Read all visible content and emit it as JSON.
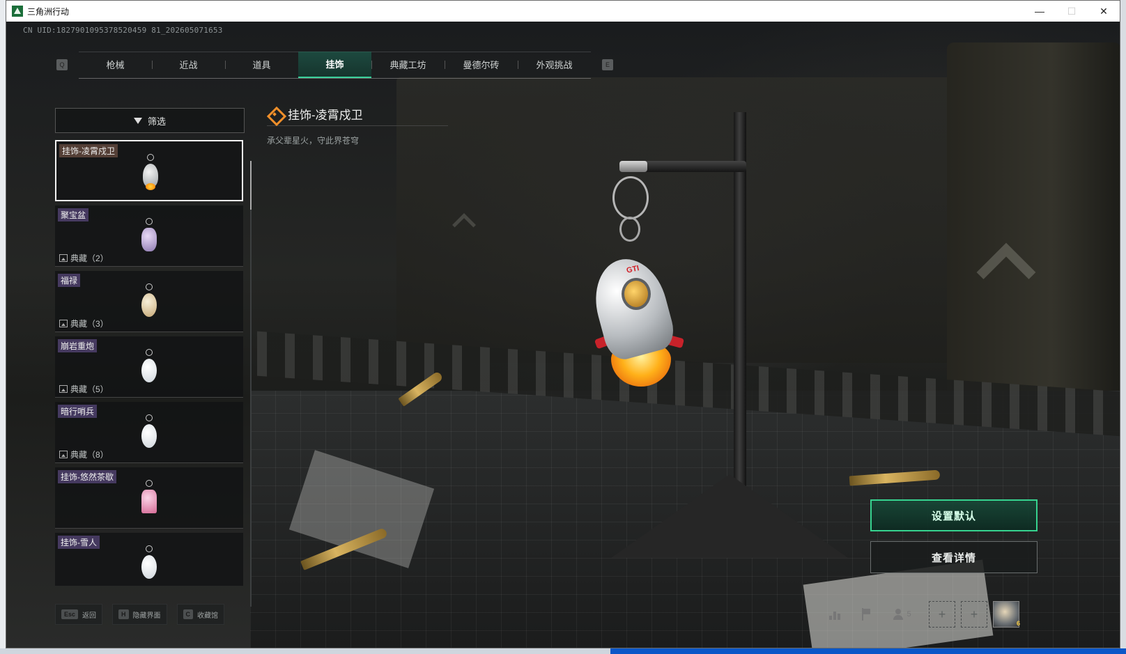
{
  "window": {
    "title": "三角洲行动",
    "controls": [
      "—",
      "☐",
      "✕"
    ]
  },
  "uid": "CN UID:1827901095378520459 81_202605071653",
  "tabs": {
    "left_key": "Q",
    "right_key": "E",
    "items": [
      {
        "label": "枪械"
      },
      {
        "label": "近战"
      },
      {
        "label": "道具"
      },
      {
        "label": "挂饰",
        "active": true
      },
      {
        "label": "典藏工坊"
      },
      {
        "label": "曼德尔砖"
      },
      {
        "label": "外观挑战"
      }
    ]
  },
  "sidebar": {
    "filter_label": "筛选",
    "items": [
      {
        "name": "挂饰-凌霄戍卫",
        "collect": "",
        "style": "rocket",
        "selected": true
      },
      {
        "name": "聚宝盆",
        "collect": "典藏（2）",
        "style": "pot"
      },
      {
        "name": "福禄",
        "collect": "典藏（3）",
        "style": "gourd"
      },
      {
        "name": "崩岩重炮",
        "collect": "典藏（5）",
        "style": "snow"
      },
      {
        "name": "暗行哨兵",
        "collect": "典藏（8）",
        "style": "snow"
      },
      {
        "name": "挂饰-悠然茶歇",
        "collect": "",
        "style": "cake"
      },
      {
        "name": "挂饰-雪人",
        "collect": "",
        "style": "snow"
      }
    ]
  },
  "detail": {
    "title": "挂饰-凌霄戍卫",
    "description": "承父辈星火，守此界苍穹",
    "badge_text": "GTI"
  },
  "actions": {
    "set_default": "设置默认",
    "view_details": "查看详情"
  },
  "bottom_bar": {
    "hotkeys": [
      {
        "key": "Esc",
        "label": "返回"
      },
      {
        "key": "H",
        "label": "隐藏界面"
      },
      {
        "key": "C",
        "label": "收藏馆"
      }
    ]
  },
  "status": {
    "friends_count": "5",
    "plus_symbol": "+",
    "avatar_level": "6"
  }
}
